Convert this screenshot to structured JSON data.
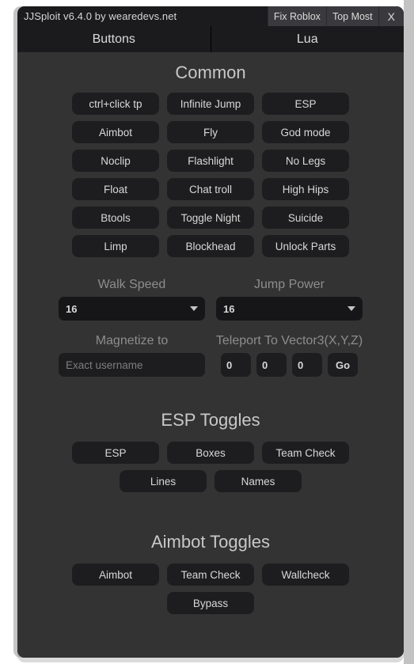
{
  "window": {
    "title": "JJSploit v6.4.0 by wearedevs.net",
    "titlebar_buttons": [
      {
        "label": "Fix Roblox",
        "name": "fix-roblox-button"
      },
      {
        "label": "Top Most",
        "name": "top-most-button"
      },
      {
        "label": "X",
        "name": "close-button"
      }
    ],
    "colors": {
      "titlebar_bg": "#1b1b1d",
      "body_bg": "#333333",
      "button_bg": "#1d1d1f",
      "text": "#d8d8d8",
      "label_text": "#8d8d8d"
    }
  },
  "tabs": [
    {
      "label": "Buttons",
      "active": true
    },
    {
      "label": "Lua",
      "active": false
    }
  ],
  "common": {
    "title": "Common",
    "rows": [
      [
        "ctrl+click tp",
        "Infinite Jump",
        "ESP"
      ],
      [
        "Aimbot",
        "Fly",
        "God mode"
      ],
      [
        "Noclip",
        "Flashlight",
        "No Legs"
      ],
      [
        "Float",
        "Chat troll",
        "High Hips"
      ],
      [
        "Btools",
        "Toggle Night",
        "Suicide"
      ],
      [
        "Limp",
        "Blockhead",
        "Unlock Parts"
      ]
    ]
  },
  "fields": {
    "walk_speed": {
      "label": "Walk Speed",
      "value": "16"
    },
    "jump_power": {
      "label": "Jump Power",
      "value": "16"
    },
    "magnetize": {
      "label": "Magnetize to",
      "value": "",
      "placeholder": "Exact username"
    },
    "teleport": {
      "label": "Teleport To Vector3(X,Y,Z)",
      "x": "0",
      "y": "0",
      "z": "0",
      "go_label": "Go"
    }
  },
  "esp_toggles": {
    "title": "ESP Toggles",
    "rows": [
      [
        "ESP",
        "Boxes",
        "Team Check"
      ],
      [
        "Lines",
        "Names"
      ]
    ]
  },
  "aimbot_toggles": {
    "title": "Aimbot Toggles",
    "rows": [
      [
        "Aimbot",
        "Team Check",
        "Wallcheck"
      ],
      [
        "Bypass"
      ]
    ]
  }
}
